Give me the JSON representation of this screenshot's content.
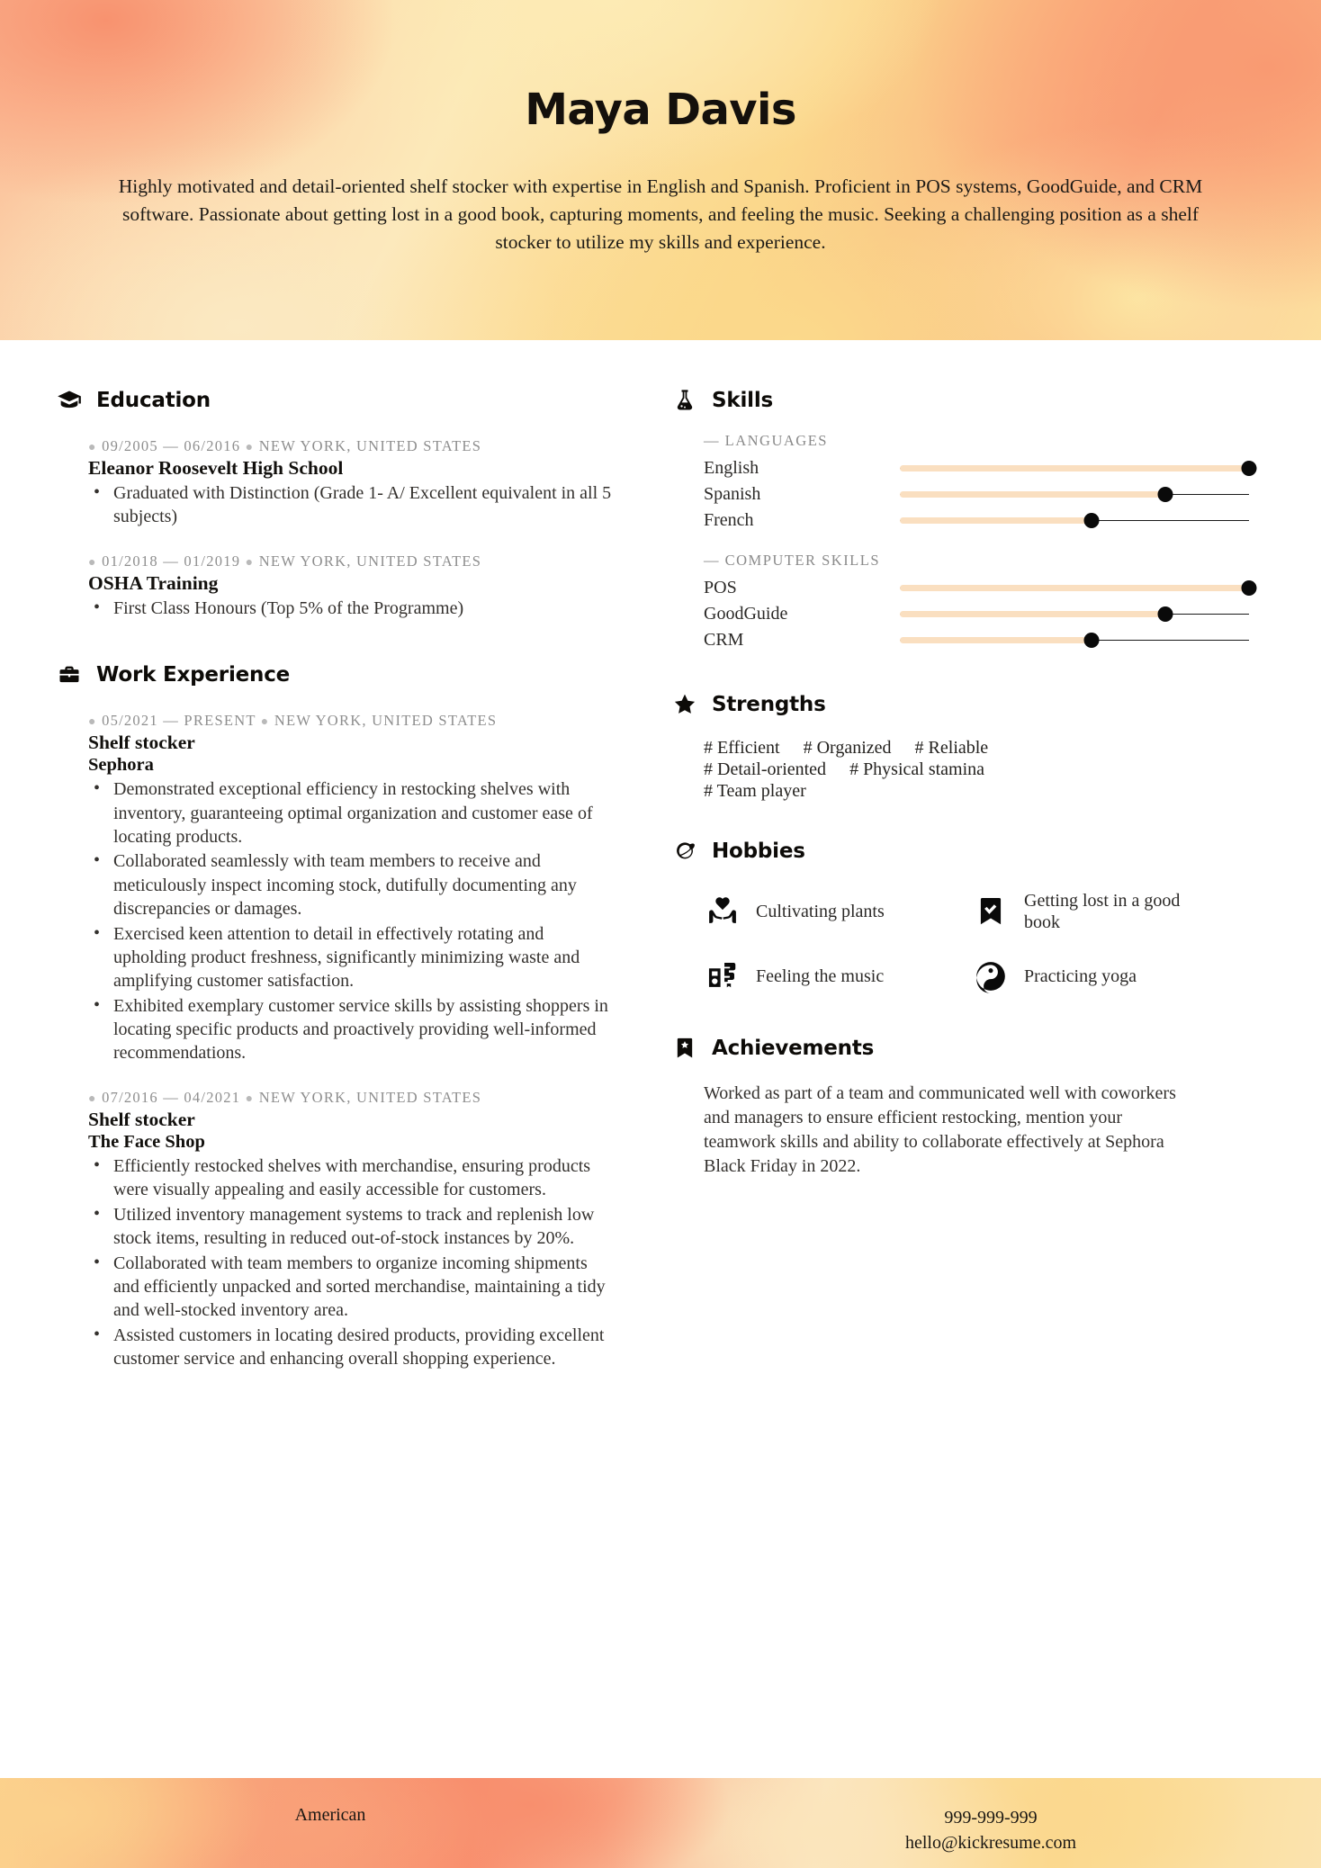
{
  "header": {
    "name": "Maya Davis",
    "summary": "Highly motivated and detail-oriented shelf stocker with expertise in English and Spanish. Proficient in POS systems, GoodGuide, and CRM software. Passionate about getting lost in a good book, capturing moments, and feeling the music. Seeking a challenging position as a shelf stocker to utilize my skills and experience."
  },
  "education": {
    "title": "Education",
    "entries": [
      {
        "dates": "09/2005 — 06/2016",
        "location": "NEW YORK, UNITED STATES",
        "title": "Eleanor Roosevelt High School",
        "bullets": [
          "Graduated with Distinction (Grade 1- A/ Excellent equivalent in all 5 subjects)"
        ]
      },
      {
        "dates": "01/2018 — 01/2019",
        "location": "NEW YORK, UNITED STATES",
        "title": "OSHA Training",
        "bullets": [
          "First Class Honours (Top 5% of the Programme)"
        ]
      }
    ]
  },
  "work": {
    "title": "Work Experience",
    "entries": [
      {
        "dates": "05/2021 — PRESENT",
        "location": "NEW YORK, UNITED STATES",
        "title": "Shelf stocker",
        "company": "Sephora",
        "bullets": [
          "Demonstrated exceptional efficiency in restocking shelves with inventory, guaranteeing optimal organization and customer ease of locating products.",
          "Collaborated seamlessly with team members to receive and meticulously inspect incoming stock, dutifully documenting any discrepancies or damages.",
          "Exercised keen attention to detail in effectively rotating and upholding product freshness, significantly minimizing waste and amplifying customer satisfaction.",
          "Exhibited exemplary customer service skills by assisting shoppers in locating specific products and proactively providing well-informed recommendations."
        ]
      },
      {
        "dates": "07/2016 — 04/2021",
        "location": "NEW YORK, UNITED STATES",
        "title": "Shelf stocker",
        "company": "The Face Shop",
        "bullets": [
          "Efficiently restocked shelves with merchandise, ensuring products were visually appealing and easily accessible for customers.",
          "Utilized inventory management systems to track and replenish low stock items, resulting in reduced out-of-stock instances by 20%.",
          "Collaborated with team members to organize incoming shipments and efficiently unpacked and sorted merchandise, maintaining a tidy and well-stocked inventory area.",
          "Assisted customers in locating desired products, providing excellent customer service and enhancing overall shopping experience."
        ]
      }
    ]
  },
  "skills": {
    "title": "Skills",
    "groups": [
      {
        "label": "— LANGUAGES",
        "items": [
          {
            "name": "English",
            "level": 100
          },
          {
            "name": "Spanish",
            "level": 76
          },
          {
            "name": "French",
            "level": 55
          }
        ]
      },
      {
        "label": "— COMPUTER SKILLS",
        "items": [
          {
            "name": "POS",
            "level": 100
          },
          {
            "name": "GoodGuide",
            "level": 76
          },
          {
            "name": "CRM",
            "level": 55
          }
        ]
      }
    ]
  },
  "strengths": {
    "title": "Strengths",
    "items": [
      "# Efficient",
      "# Organized",
      "# Reliable",
      "# Detail-oriented",
      "# Physical stamina",
      "# Team player"
    ]
  },
  "hobbies": {
    "title": "Hobbies",
    "items": [
      {
        "label": "Cultivating plants",
        "icon": "hands-heart-icon"
      },
      {
        "label": "Getting lost in a good book",
        "icon": "bookmark-check-icon"
      },
      {
        "label": "Feeling the music",
        "icon": "boombox-icon"
      },
      {
        "label": "Practicing yoga",
        "icon": "yin-yang-icon"
      }
    ]
  },
  "achievements": {
    "title": "Achievements",
    "body": "Worked as part of a team and communicated well with coworkers and managers to ensure efficient restocking, mention your teamwork skills and ability to collaborate effectively at Sephora Black Friday in 2022."
  },
  "footer": {
    "nationality": "American",
    "phone": "999-999-999",
    "email": "hello@kickresume.com"
  },
  "colors": {
    "accent_fill": "#fadfc0",
    "ink": "#0d0b08",
    "muted": "#8e8e8e"
  }
}
